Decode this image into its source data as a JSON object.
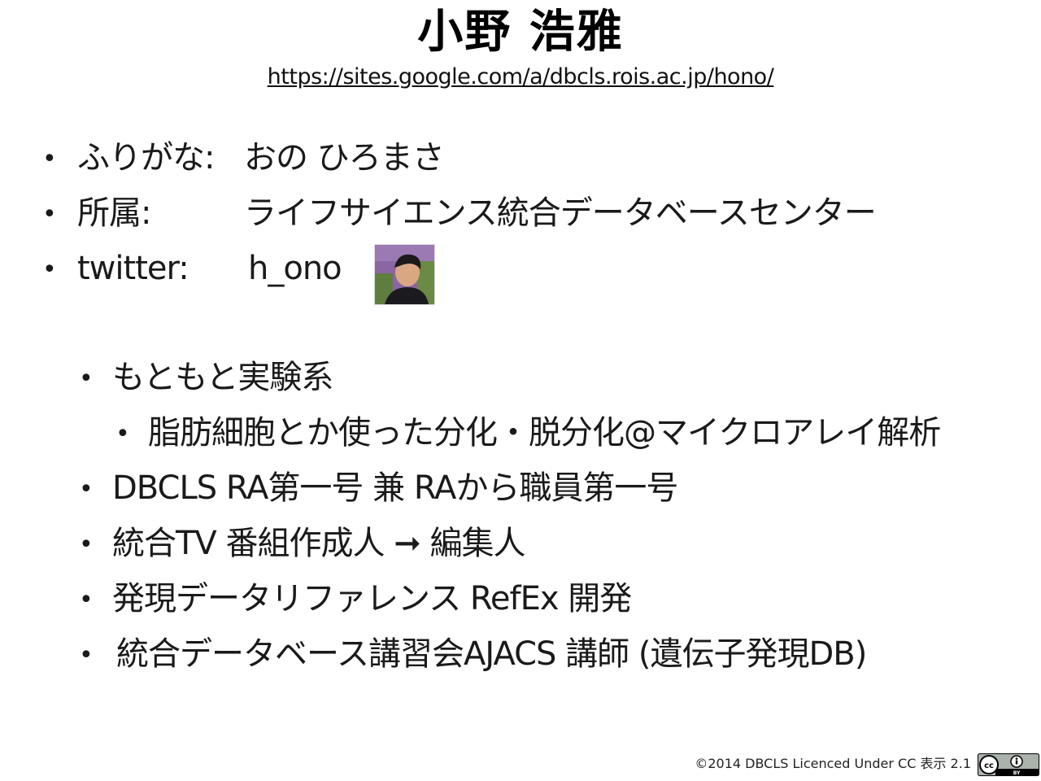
{
  "header": {
    "title": "小野 浩雅",
    "url": "https://sites.google.com/a/dbcls.rois.ac.jp/hono/"
  },
  "profile": [
    {
      "label": "ふりがな:",
      "value": "おの ひろまさ"
    },
    {
      "label": "所属:",
      "value": "ライフサイエンス統合データベースセンター"
    },
    {
      "label": "twitter:",
      "value": "h_ono"
    }
  ],
  "career": [
    {
      "text": "もともと実験系",
      "level": 1
    },
    {
      "text": "脂肪細胞とか使った分化・脱分化@マイクロアレイ解析",
      "level": 2
    },
    {
      "text": "DBCLS RA第一号 兼 RAから職員第一号",
      "level": 1
    },
    {
      "text": "統合TV 番組作成人 ➞ 編集人",
      "level": 1
    },
    {
      "text": "発現データリファレンス RefEx 開発",
      "level": 1
    },
    {
      "text": "統合データベース講習会AJACS 講師 (遺伝子発現DB)",
      "level": 1
    }
  ],
  "footer": {
    "copyright": "©2014 DBCLS Licenced Under CC 表示 2.1",
    "badge_text": "BY"
  },
  "icons": {
    "avatar": "avatar-photo",
    "cc": "cc-by-icon"
  }
}
